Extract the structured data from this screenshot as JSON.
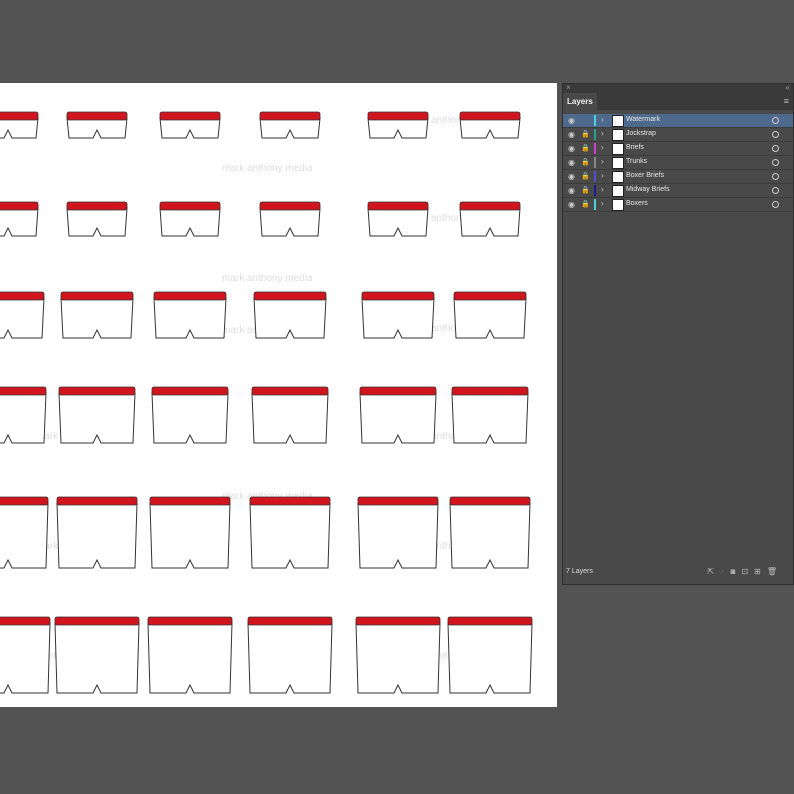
{
  "artboard": {
    "watermark_text": "mark anthony media",
    "waistband_color": "#d0151f"
  },
  "panel": {
    "close": "×",
    "collapse": "«",
    "tab_label": "Layers",
    "menu_icon": "≡",
    "layers": [
      {
        "name": "Watermark",
        "color": "#4ad0e0",
        "selected": true,
        "locked": false
      },
      {
        "name": "Jockstrap",
        "color": "#1fa38a",
        "selected": false,
        "locked": true
      },
      {
        "name": "Briefs",
        "color": "#d23fd2",
        "selected": false,
        "locked": true
      },
      {
        "name": "Trunks",
        "color": "#888888",
        "selected": false,
        "locked": true
      },
      {
        "name": "Boxer Briefs",
        "color": "#4f4fd8",
        "selected": false,
        "locked": true
      },
      {
        "name": "Midway Briefs",
        "color": "#1a1a9a",
        "selected": false,
        "locked": true
      },
      {
        "name": "Boxers",
        "color": "#4ad0e0",
        "selected": false,
        "locked": true
      }
    ],
    "footer": {
      "count": "7 Layers",
      "icons": [
        "export-icon",
        "locate-object-icon",
        "clipping-mask-icon",
        "new-sublayer-icon",
        "new-layer-icon",
        "trash-icon"
      ]
    }
  }
}
